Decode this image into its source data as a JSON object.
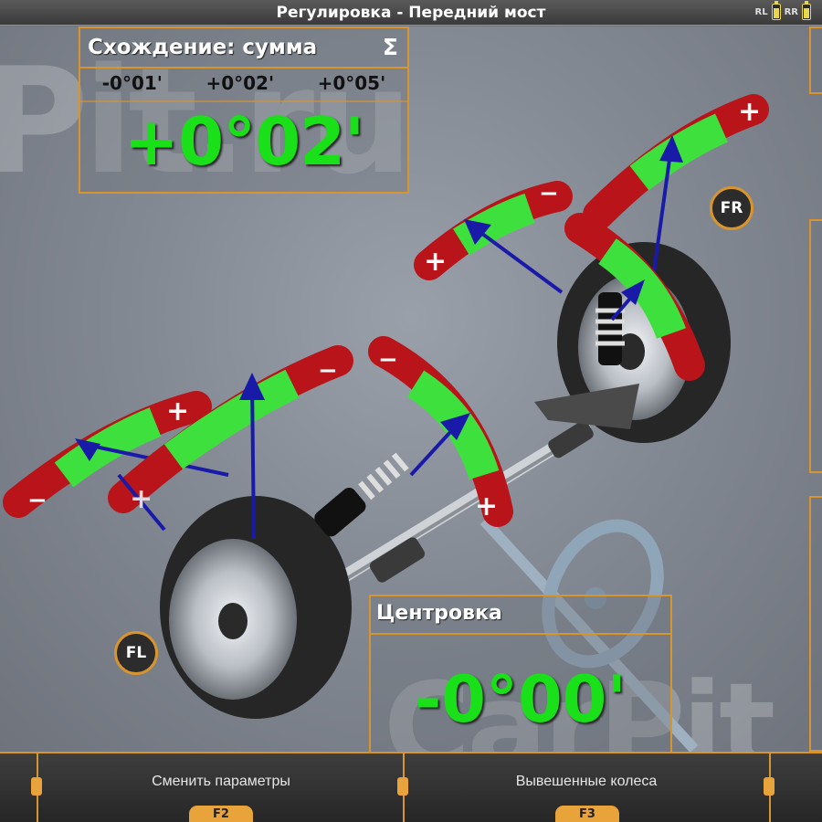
{
  "window": {
    "title": "Регулировка - Передний мост",
    "sensors": [
      {
        "label": "RL",
        "level": 0.8
      },
      {
        "label": "RR",
        "level": 0.8
      }
    ]
  },
  "toe_total": {
    "title": "Схождение: сумма",
    "symbol": "Σ",
    "values": [
      "-0°01'",
      "+0°02'",
      "+0°05'"
    ],
    "main_value": "+0°02'"
  },
  "centering": {
    "title": "Центровка",
    "main_value": "-0°00'"
  },
  "wheels": {
    "front_left": "FL",
    "front_right": "FR"
  },
  "gauge_signs": {
    "plus": "+",
    "minus": "−"
  },
  "function_bar": {
    "buttons": [
      {
        "label": "Сменить параметры",
        "key": "F2"
      },
      {
        "label": "Вывешенные колеса",
        "key": "F3"
      }
    ]
  },
  "colors": {
    "accent": "#d8952e",
    "value_green": "#19e019",
    "gauge_red": "#b8141a",
    "gauge_green": "#3ee03e",
    "pointer_blue": "#1a1aa8"
  }
}
